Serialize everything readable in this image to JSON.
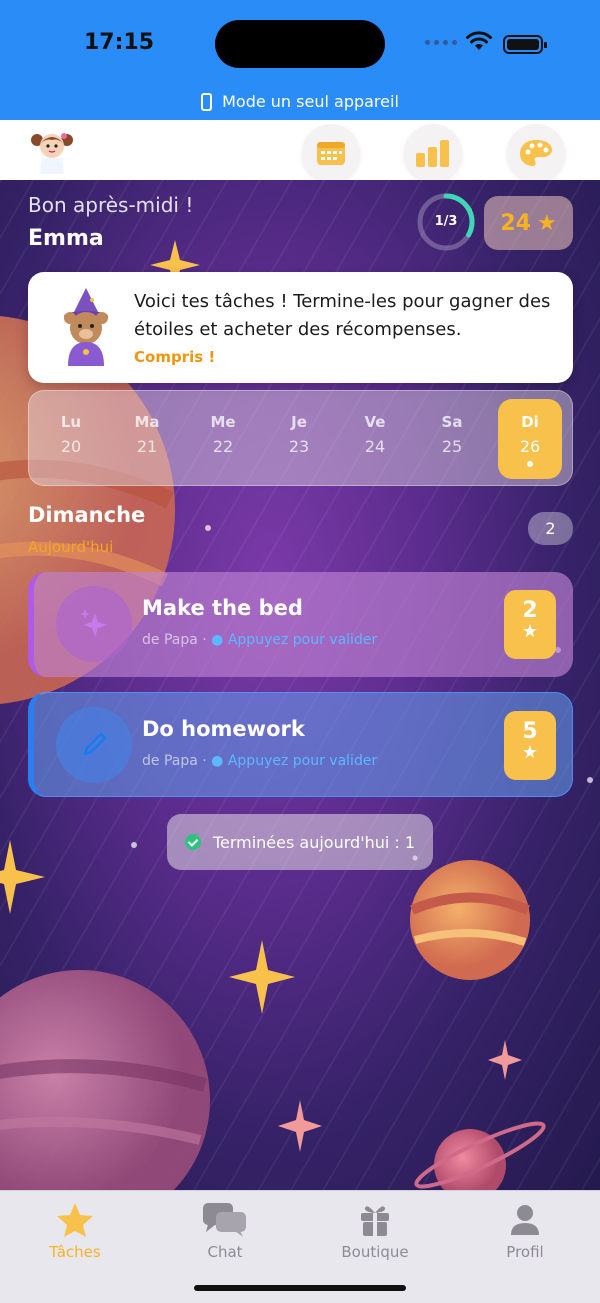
{
  "status": {
    "time": "17:15",
    "mode_label": "Mode un seul appareil"
  },
  "header": {
    "buttons": [
      "calendar",
      "stats",
      "theme"
    ]
  },
  "greeting": {
    "line": "Bon après-midi !",
    "name": "Emma"
  },
  "progress": {
    "label": "1/3",
    "fraction": 0.333
  },
  "stars": {
    "count": "24",
    "icon": "★"
  },
  "tip": {
    "text": "Voici tes tâches ! Termine-les pour gagner des étoiles et acheter des récompenses.",
    "button": "Compris !"
  },
  "week": [
    {
      "name": "Lu",
      "date": "20"
    },
    {
      "name": "Ma",
      "date": "21"
    },
    {
      "name": "Me",
      "date": "22"
    },
    {
      "name": "Je",
      "date": "23"
    },
    {
      "name": "Ve",
      "date": "24"
    },
    {
      "name": "Sa",
      "date": "25"
    },
    {
      "name": "Di",
      "date": "26"
    }
  ],
  "section": {
    "title": "Dimanche",
    "subtitle": "Aujourd'hui",
    "count": "2"
  },
  "tasks": [
    {
      "title": "Make the bed",
      "from": "de Papa",
      "sep": "·",
      "action": "Appuyez pour valider",
      "points": "2",
      "star": "★",
      "icon": "sparkle-icon",
      "color": "#b05ae6"
    },
    {
      "title": "Do homework",
      "from": "de Papa",
      "sep": "·",
      "action": "Appuyez pour valider",
      "points": "5",
      "star": "★",
      "icon": "pencil-icon",
      "color": "#2a7ef0"
    }
  ],
  "done": {
    "label": "Terminées aujourd'hui : 1"
  },
  "tabs": [
    {
      "label": "Tâches",
      "icon": "star-icon",
      "active": true
    },
    {
      "label": "Chat",
      "icon": "chat-icon",
      "active": false
    },
    {
      "label": "Boutique",
      "icon": "gift-icon",
      "active": false
    },
    {
      "label": "Profil",
      "icon": "person-icon",
      "active": false
    }
  ],
  "colors": {
    "accent": "#f8c14b",
    "status_bar": "#2a8cf6",
    "link": "#5cb8ff",
    "today_text": "#f5a623"
  }
}
